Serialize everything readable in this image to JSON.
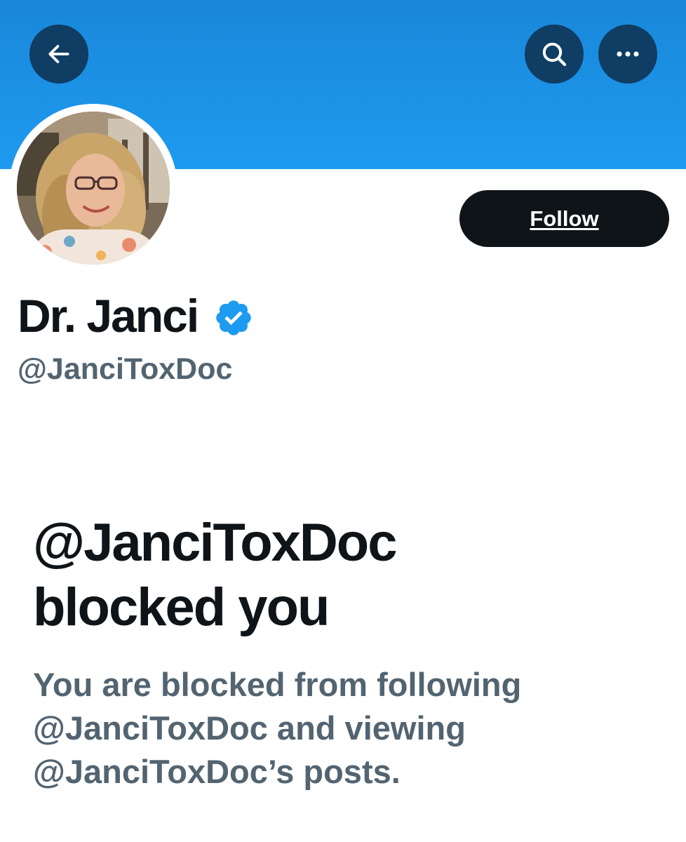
{
  "header": {
    "back_icon": "arrow-left-icon",
    "search_icon": "search-icon",
    "more_icon": "more-horizontal-icon",
    "banner_color": "#1d9bf0"
  },
  "profile": {
    "display_name": "Dr. Janci",
    "verified_icon": "verified-badge-icon",
    "verified_color": "#1d9bf0",
    "handle": "@JanciToxDoc",
    "follow_label": "Follow"
  },
  "blocked": {
    "title_line1": "@JanciToxDoc",
    "title_line2": "blocked you",
    "description_line1": "You are blocked from following",
    "description_line2": "@JanciToxDoc and viewing",
    "description_line3": "@JanciToxDoc’s posts."
  }
}
